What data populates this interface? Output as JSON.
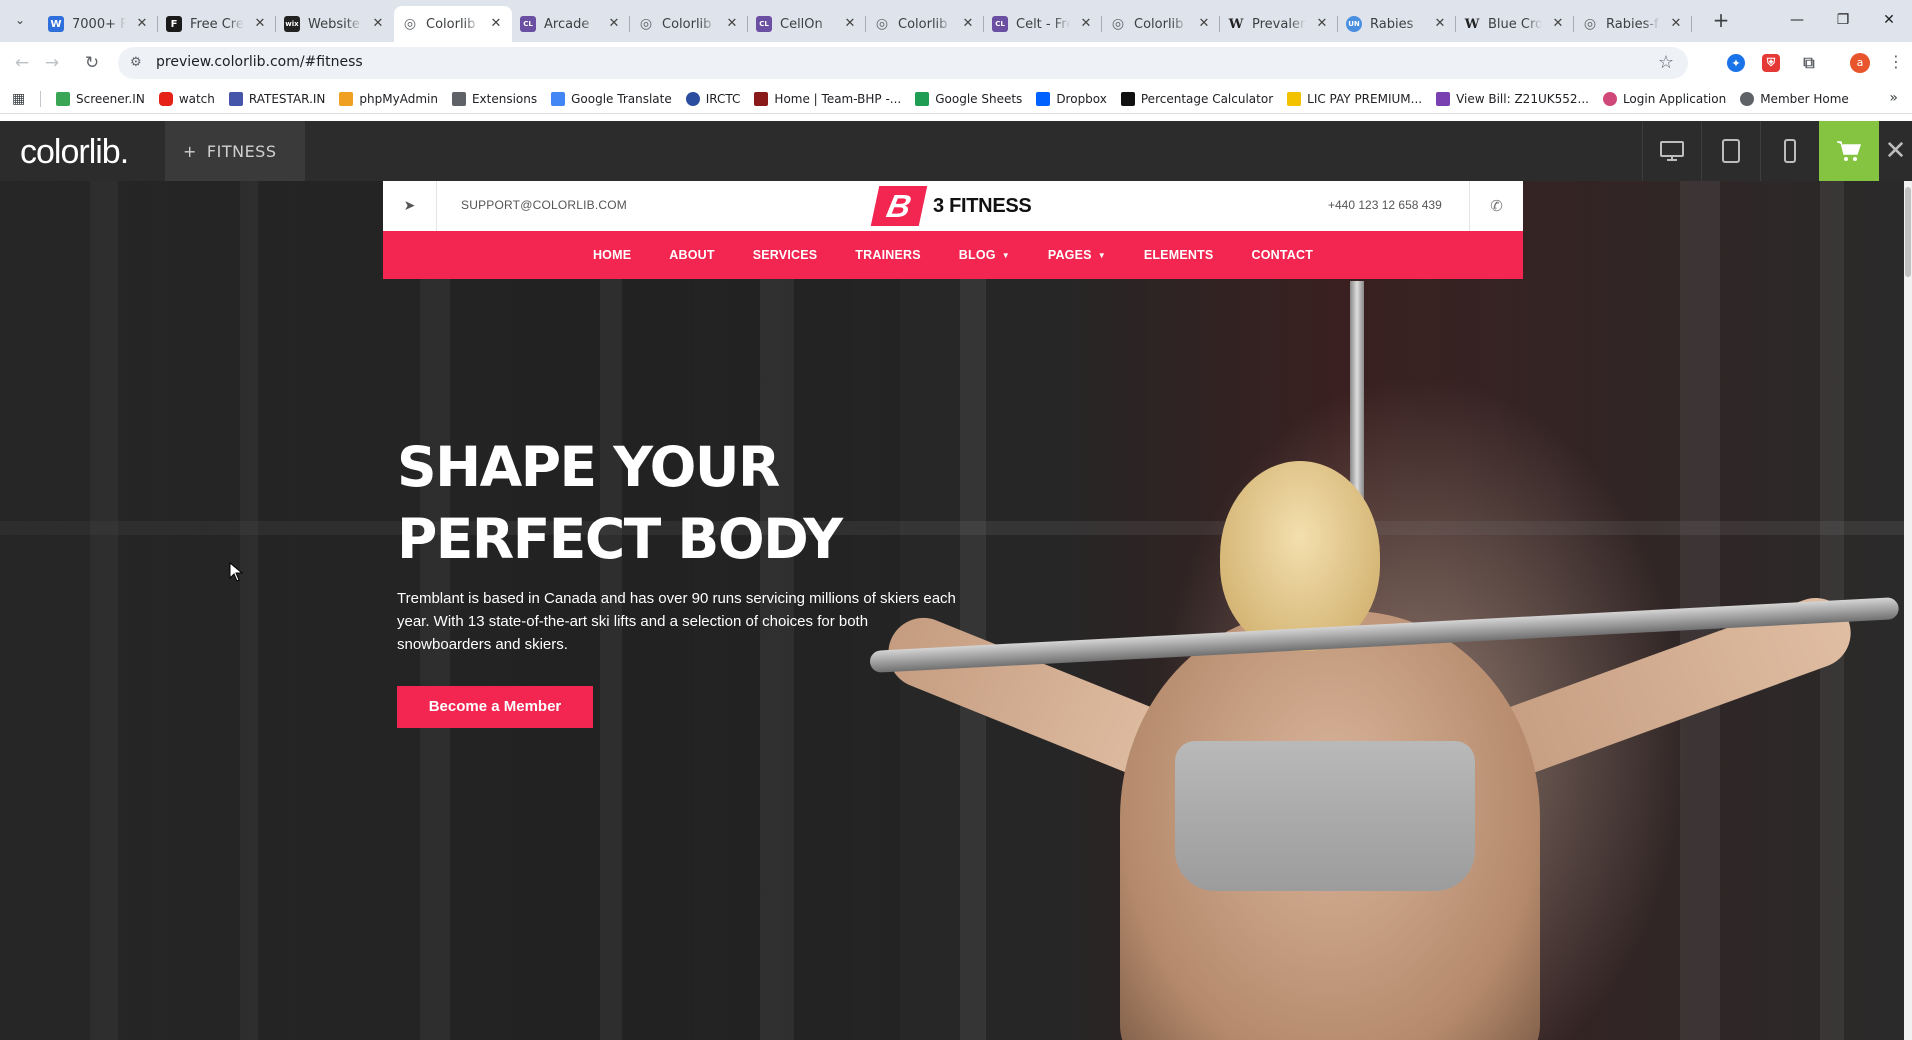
{
  "browser": {
    "tabs": [
      {
        "title": "7000+ Fr",
        "favicon": "W",
        "favicon_color": "#2f6fdb"
      },
      {
        "title": "Free Cre",
        "favicon": "F",
        "favicon_color": "#1a1a1a"
      },
      {
        "title": "Website",
        "favicon": "wix",
        "favicon_color": "#222222"
      },
      {
        "title": "Colorlib",
        "favicon": "globe",
        "favicon_color": "#5f6368",
        "active": true
      },
      {
        "title": "Arcade",
        "favicon": "CL",
        "favicon_color": "#6b4fa3"
      },
      {
        "title": "Colorlib",
        "favicon": "globe",
        "favicon_color": "#5f6368"
      },
      {
        "title": "CellOn",
        "favicon": "CL",
        "favicon_color": "#6b4fa3"
      },
      {
        "title": "Colorlib",
        "favicon": "globe",
        "favicon_color": "#5f6368"
      },
      {
        "title": "Celt - Fre",
        "favicon": "CL",
        "favicon_color": "#6b4fa3"
      },
      {
        "title": "Colorlib",
        "favicon": "globe",
        "favicon_color": "#5f6368"
      },
      {
        "title": "Prevalen",
        "favicon": "W",
        "favicon_color": "#222222"
      },
      {
        "title": "Rabies",
        "favicon": "UN",
        "favicon_color": "#4a8fe0"
      },
      {
        "title": "Blue Cro",
        "favicon": "W",
        "favicon_color": "#222222"
      },
      {
        "title": "Rabies-fr",
        "favicon": "globe",
        "favicon_color": "#5f6368"
      }
    ],
    "url": "preview.colorlib.com/#fitness",
    "bookmarks": [
      {
        "label": "Screener.IN",
        "color": "#3aa655"
      },
      {
        "label": "watch",
        "color": "#e62117"
      },
      {
        "label": "RATESTAR.IN",
        "color": "#4455aa"
      },
      {
        "label": "phpMyAdmin",
        "color": "#f0a020"
      },
      {
        "label": "Extensions",
        "color": "#5f6368"
      },
      {
        "label": "Google Translate",
        "color": "#4285f4"
      },
      {
        "label": "IRCTC",
        "color": "#2a4da0"
      },
      {
        "label": "Home | Team-BHP -...",
        "color": "#8a1a1a"
      },
      {
        "label": "Google Sheets",
        "color": "#1f9d55"
      },
      {
        "label": "Dropbox",
        "color": "#0061ff"
      },
      {
        "label": "Percentage Calculator",
        "color": "#111111"
      },
      {
        "label": "LIC PAY PREMIUM...",
        "color": "#f2c200"
      },
      {
        "label": "View Bill: Z21UK552...",
        "color": "#7a3fb0"
      },
      {
        "label": "Login Application",
        "color": "#d0487a"
      },
      {
        "label": "Member Home",
        "color": "#5f6368"
      }
    ],
    "profile_initial": "a"
  },
  "preview_bar": {
    "logo": "colorlib.",
    "theme_label": "FITNESS"
  },
  "site": {
    "email": "SUPPORT@COLORLIB.COM",
    "brand_mark": "B",
    "brand_name": "3 FITNESS",
    "phone": "+440 123 12 658 439",
    "nav": [
      {
        "label": "HOME"
      },
      {
        "label": "ABOUT"
      },
      {
        "label": "SERVICES"
      },
      {
        "label": "TRAINERS"
      },
      {
        "label": "BLOG",
        "dropdown": true
      },
      {
        "label": "PAGES",
        "dropdown": true
      },
      {
        "label": "ELEMENTS"
      },
      {
        "label": "CONTACT"
      }
    ],
    "hero": {
      "title_line1": "SHAPE YOUR",
      "title_line2": "PERFECT BODY",
      "text": "Tremblant is based in Canada and has over 90 runs servicing millions of skiers each year. With 13 state-of-the-art ski lifts and a selection of choices for both snowboarders and skiers.",
      "cta": "Become a Member"
    },
    "accent_color": "#f22651"
  }
}
